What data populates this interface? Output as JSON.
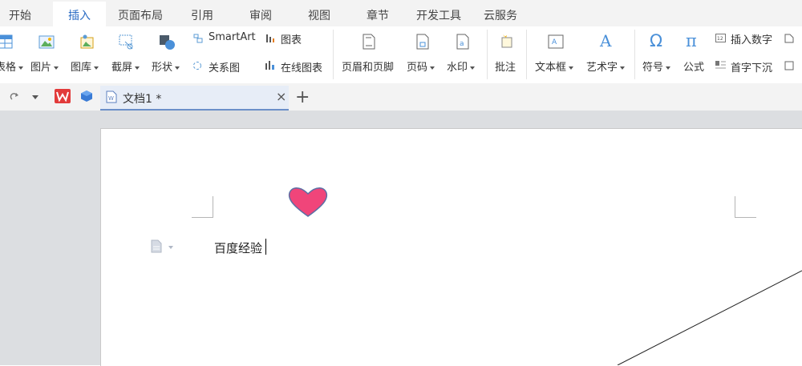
{
  "menubar": {
    "tabs": [
      {
        "label": "开始"
      },
      {
        "label": "插入",
        "active": true
      },
      {
        "label": "页面布局"
      },
      {
        "label": "引用"
      },
      {
        "label": "审阅"
      },
      {
        "label": "视图"
      },
      {
        "label": "章节"
      },
      {
        "label": "开发工具"
      },
      {
        "label": "云服务"
      }
    ]
  },
  "ribbon": {
    "table_label": "表格",
    "picture_label": "图片",
    "gallery_label": "图库",
    "screenshot_label": "截屏",
    "shape_label": "形状",
    "smartart_label": "SmartArt",
    "relation_label": "关系图",
    "chart_label": "图表",
    "online_chart_label": "在线图表",
    "header_footer_label": "页眉和页脚",
    "page_number_label": "页码",
    "watermark_label": "水印",
    "comment_label": "批注",
    "textbox_label": "文本框",
    "wordart_label": "艺术字",
    "symbol_label": "符号",
    "formula_label": "公式",
    "insert_number_label": "插入数字",
    "dropcap_label": "首字下沉"
  },
  "tabbar": {
    "doc_title": "文档1 *",
    "close_glyph": "×",
    "new_tab_glyph": "+"
  },
  "document": {
    "body_text": "百度经验"
  },
  "colors": {
    "accent": "#2b6cc4",
    "heart_fill": "#f0457a",
    "heart_stroke": "#5a6fa5",
    "wps_red": "#e23b3b"
  }
}
